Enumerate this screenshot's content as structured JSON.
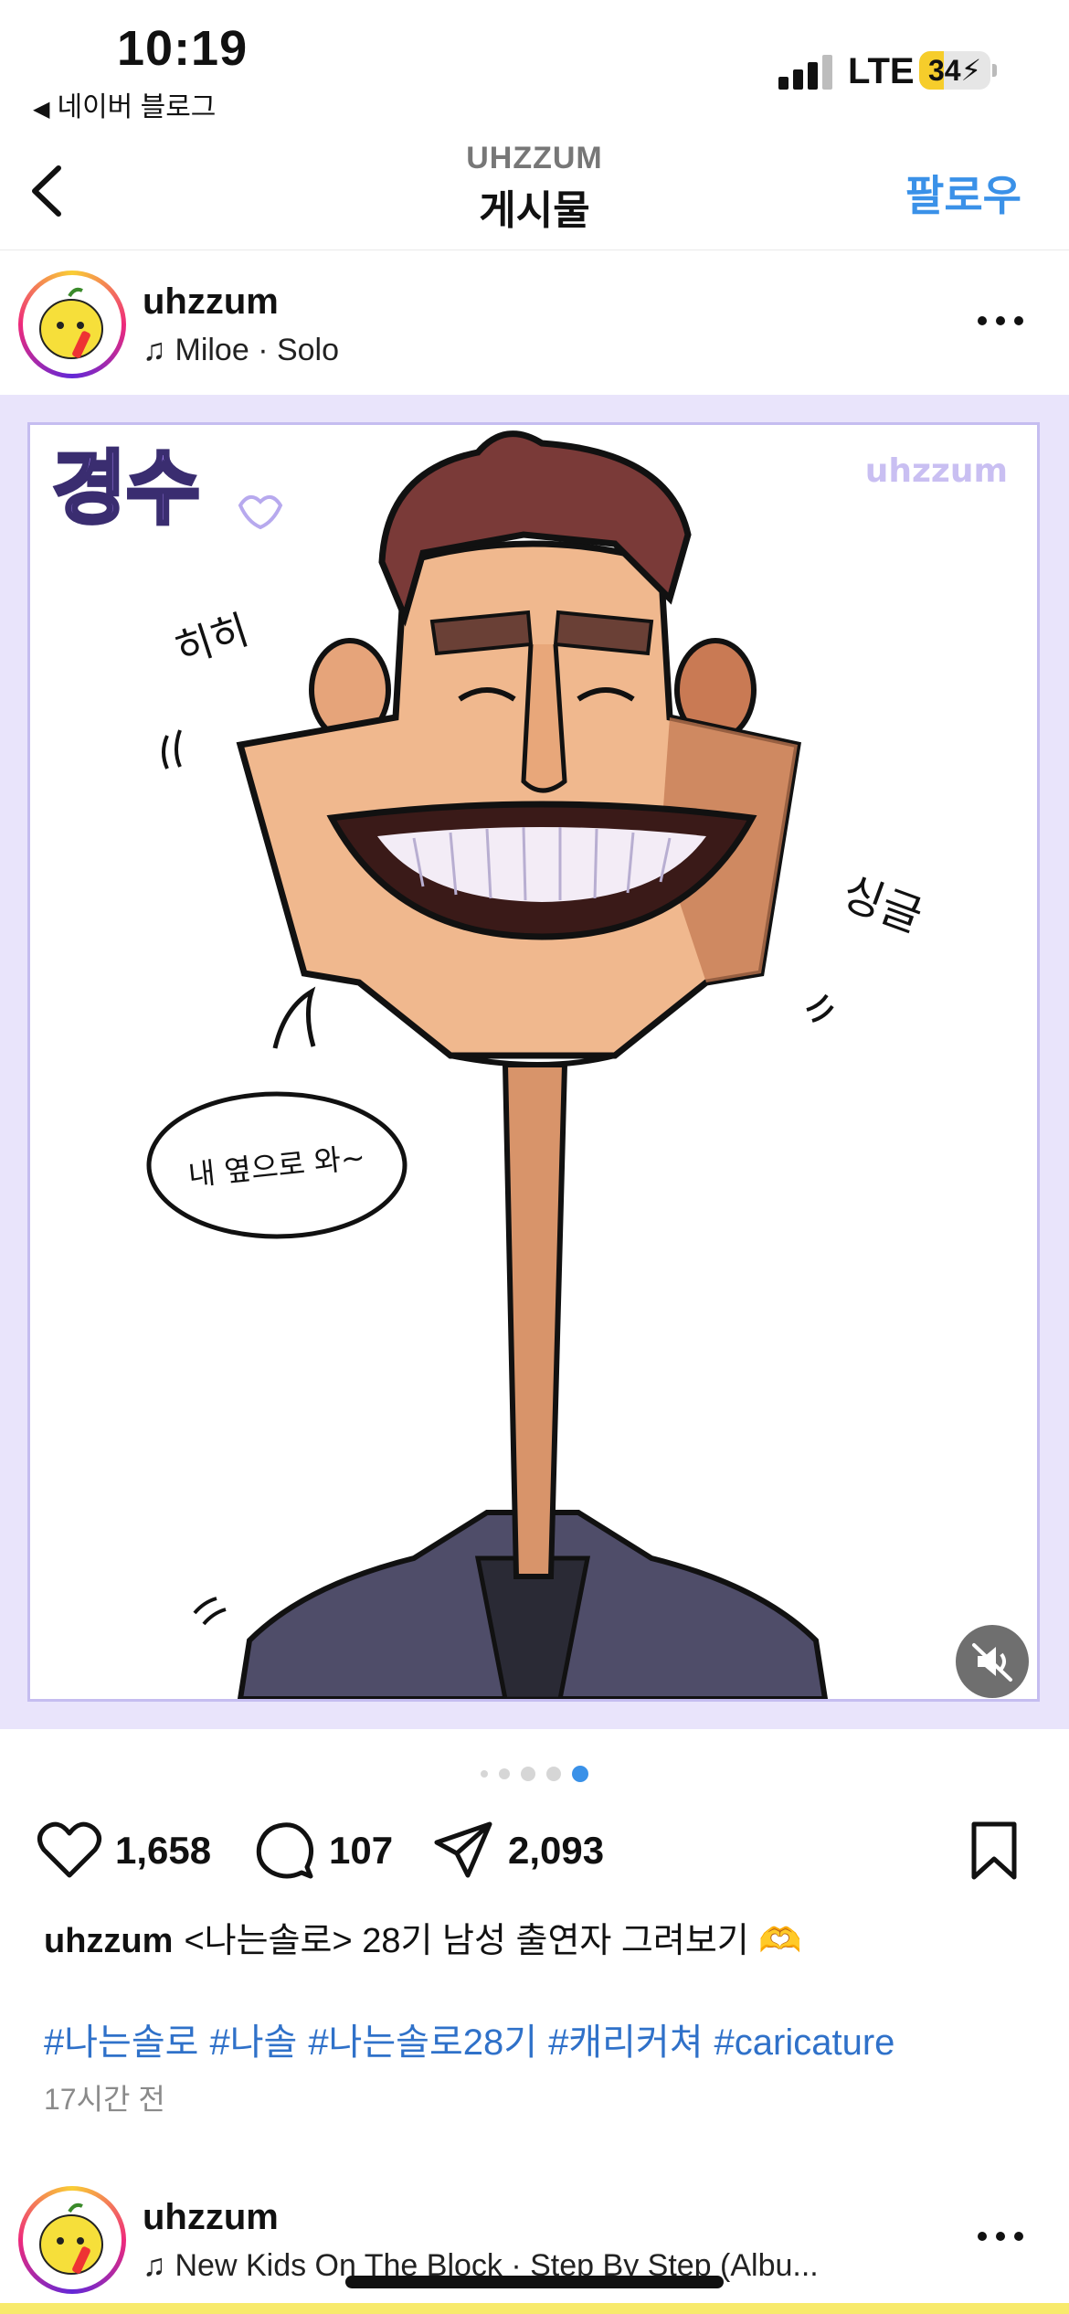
{
  "status_bar": {
    "time": "10:19",
    "back_app": "네이버 블로그",
    "network": "LTE",
    "battery": "34",
    "battery_level": 0.34
  },
  "nav": {
    "subtitle": "UHZZUM",
    "title": "게시물",
    "follow_label": "팔로우"
  },
  "post": {
    "username": "uhzzum",
    "music": "Miloe · Solo",
    "image": {
      "name_text": "경수",
      "watermark": "uhzzum",
      "sfx_left": "히히",
      "sfx_right": "싱글",
      "speech": "내 옆으로 와~"
    },
    "carousel": {
      "count": 5,
      "active": 4
    },
    "likes": "1,658",
    "comments": "107",
    "shares": "2,093",
    "caption": "<나는솔로> 28기 남성 출연자 그려보기 🫶",
    "hashtags": [
      "#나는솔로",
      "#나솔",
      "#나는솔로28기",
      "#캐리커쳐",
      "#caricature"
    ],
    "time_ago": "17시간 전"
  },
  "next_post": {
    "username": "uhzzum",
    "music": "New Kids On The Block · Step By Step (Albu..."
  },
  "colors": {
    "accent": "#3a91e8",
    "hashtag": "#2f71c9",
    "image_bg": "#e9e4fb",
    "name_purple": "#9b7ae6"
  },
  "icons": [
    "back-chevron-icon",
    "music-note-icon",
    "more-icon",
    "mute-icon",
    "heart-icon",
    "comment-icon",
    "share-icon",
    "bookmark-icon"
  ]
}
